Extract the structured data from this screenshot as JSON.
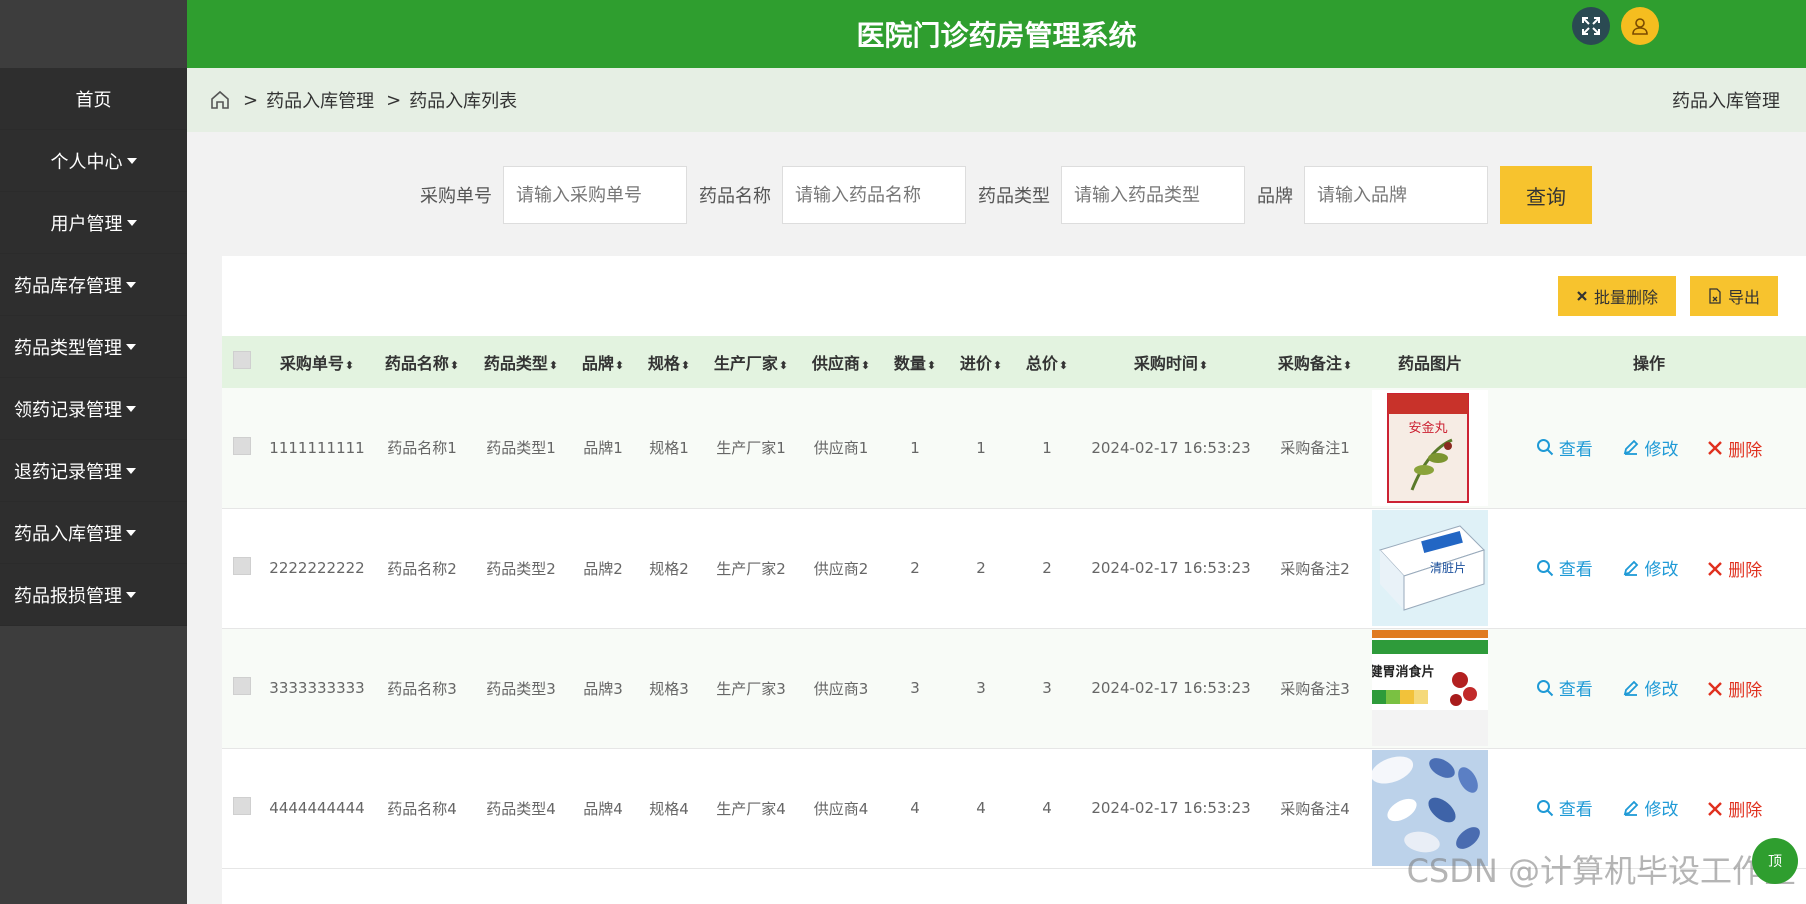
{
  "app": {
    "title": "医院门诊药房管理系统"
  },
  "sidebar": {
    "items": [
      {
        "label": "首页",
        "has_caret": false
      },
      {
        "label": "个人中心",
        "has_caret": true
      },
      {
        "label": "用户管理",
        "has_caret": true
      },
      {
        "label": "药品库存管理",
        "has_caret": true
      },
      {
        "label": "药品类型管理",
        "has_caret": true
      },
      {
        "label": "领药记录管理",
        "has_caret": true
      },
      {
        "label": "退药记录管理",
        "has_caret": true
      },
      {
        "label": "药品入库管理",
        "has_caret": true
      },
      {
        "label": "药品报损管理",
        "has_caret": true
      }
    ]
  },
  "breadcrumb": {
    "sep": ">",
    "items": [
      "药品入库管理",
      "药品入库列表"
    ],
    "right_title": "药品入库管理"
  },
  "search": {
    "fields": [
      {
        "label": "采购单号",
        "placeholder": "请输入采购单号"
      },
      {
        "label": "药品名称",
        "placeholder": "请输入药品名称"
      },
      {
        "label": "药品类型",
        "placeholder": "请输入药品类型"
      },
      {
        "label": "品牌",
        "placeholder": "请输入品牌"
      }
    ],
    "query_label": "查询"
  },
  "toolbar": {
    "batch_delete_label": "批量删除",
    "export_label": "导出"
  },
  "table": {
    "columns": [
      "采购单号",
      "药品名称",
      "药品类型",
      "品牌",
      "规格",
      "生产厂家",
      "供应商",
      "数量",
      "进价",
      "总价",
      "采购时间",
      "采购备注",
      "药品图片",
      "操作"
    ],
    "sortable_marker": "⬍",
    "actions": {
      "view": "查看",
      "edit": "修改",
      "delete": "删除"
    },
    "rows": [
      {
        "order_no": "1111111111",
        "name": "药品名称1",
        "type": "药品类型1",
        "brand": "品牌1",
        "spec": "规格1",
        "maker": "生产厂家1",
        "supplier": "供应商1",
        "qty": "1",
        "price": "1",
        "total": "1",
        "time": "2024-02-17 16:53:23",
        "remark": "采购备注1",
        "image": "medicine-box-herbal",
        "image_text": "安金丸"
      },
      {
        "order_no": "2222222222",
        "name": "药品名称2",
        "type": "药品类型2",
        "brand": "品牌2",
        "spec": "规格2",
        "maker": "生产厂家2",
        "supplier": "供应商2",
        "qty": "2",
        "price": "2",
        "total": "2",
        "time": "2024-02-17 16:53:23",
        "remark": "采购备注2",
        "image": "medicine-box-blue",
        "image_text": "清脏片"
      },
      {
        "order_no": "3333333333",
        "name": "药品名称3",
        "type": "药品类型3",
        "brand": "品牌3",
        "spec": "规格3",
        "maker": "生产厂家3",
        "supplier": "供应商3",
        "qty": "3",
        "price": "3",
        "total": "3",
        "time": "2024-02-17 16:53:23",
        "remark": "采购备注3",
        "image": "medicine-box-green",
        "image_text": "健胃消食片"
      },
      {
        "order_no": "4444444444",
        "name": "药品名称4",
        "type": "药品类型4",
        "brand": "品牌4",
        "spec": "规格4",
        "maker": "生产厂家4",
        "supplier": "供应商4",
        "qty": "4",
        "price": "4",
        "total": "4",
        "time": "2024-02-17 16:53:23",
        "remark": "采购备注4",
        "image": "pills-photo",
        "image_text": ""
      }
    ]
  },
  "watermark": "CSDN @计算机毕设工作室",
  "fab_label": "顶",
  "colors": {
    "header": "#2f9e2f",
    "sidebar": "#2e2e2e",
    "accent": "#f7c32e",
    "link": "#1f9ad6",
    "danger": "#e0301e"
  }
}
